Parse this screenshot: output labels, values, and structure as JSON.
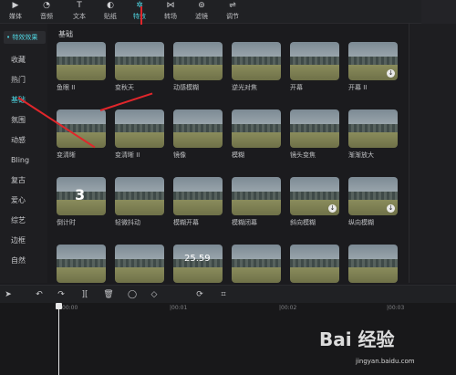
{
  "toolbar": {
    "items": [
      {
        "label": "媒体",
        "icon": "media-icon"
      },
      {
        "label": "音频",
        "icon": "audio-icon"
      },
      {
        "label": "文本",
        "icon": "text-icon"
      },
      {
        "label": "贴纸",
        "icon": "sticker-icon"
      },
      {
        "label": "特效",
        "icon": "effects-icon",
        "active": true
      },
      {
        "label": "转场",
        "icon": "transition-icon"
      },
      {
        "label": "滤镜",
        "icon": "filter-icon"
      },
      {
        "label": "调节",
        "icon": "adjust-icon"
      }
    ]
  },
  "sidebar": {
    "header": "• 特效效果",
    "items": [
      "收藏",
      "热门",
      "基础",
      "氛围",
      "动感",
      "Bling",
      "复古",
      "爱心",
      "综艺",
      "边框",
      "自然"
    ],
    "active": "基础"
  },
  "content": {
    "section_title": "基础",
    "rows": [
      [
        {
          "label": "鱼眼 II"
        },
        {
          "label": "变秋天"
        },
        {
          "label": "动感模糊"
        },
        {
          "label": "逆光对焦"
        },
        {
          "label": "开幕"
        },
        {
          "label": "开幕 II",
          "download": true
        }
      ],
      [
        {
          "label": "变清晰"
        },
        {
          "label": "变清晰 II"
        },
        {
          "label": "镜像"
        },
        {
          "label": "模糊"
        },
        {
          "label": "镜头变焦"
        },
        {
          "label": "渐渐放大"
        }
      ],
      [
        {
          "label": "倒计时",
          "overlay": "3"
        },
        {
          "label": "轻微抖动"
        },
        {
          "label": "模糊开幕"
        },
        {
          "label": "模糊闭幕"
        },
        {
          "label": "斜向模糊",
          "download": true
        },
        {
          "label": "纵向模糊",
          "download": true
        }
      ],
      [
        {
          "label": ""
        },
        {
          "label": ""
        },
        {
          "label": "",
          "overlay": "25.59"
        },
        {
          "label": ""
        },
        {
          "label": ""
        },
        {
          "label": ""
        }
      ]
    ]
  },
  "timeline": {
    "ticks": [
      "00:00",
      "|00:01",
      "|00:02",
      "|00:03"
    ],
    "tools": [
      "cursor-icon",
      "undo-icon",
      "redo-icon",
      "split-icon",
      "delete-icon",
      "freeze-icon",
      "mirror-icon",
      "rotate-icon",
      "crop-icon"
    ]
  },
  "watermark": {
    "text": "Bai 经验",
    "sub": "jingyan.baidu.com"
  },
  "colors": {
    "accent": "#4fd6e2",
    "arrow": "#e0262b",
    "background": "#1b1b1e"
  }
}
